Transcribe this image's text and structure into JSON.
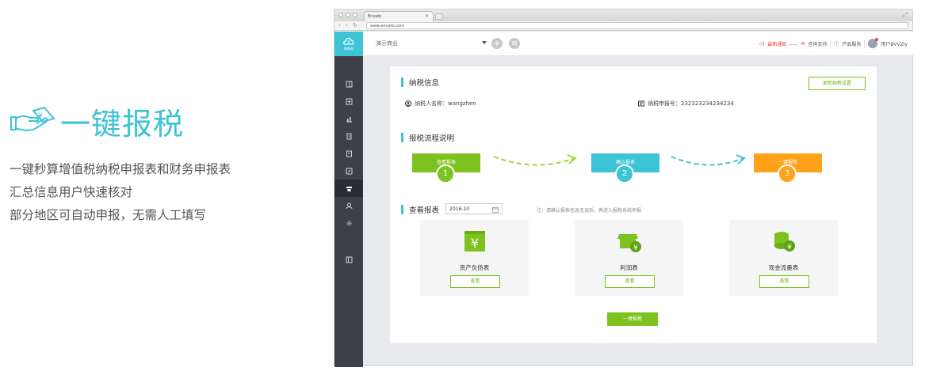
{
  "hero": {
    "title": "一键报税",
    "lines": [
      "一键秒算增值税纳税申报表和财务申报表",
      "汇总信息用户快速核对",
      "部分地区可自动申报，无需人工填写"
    ]
  },
  "browser": {
    "tab_title": "Envato",
    "url": "www.envato.com"
  },
  "app": {
    "logo_label": "税表报",
    "company_select": "演示商业",
    "notice_label": "最新通知 ——",
    "support_label": "咨询支持",
    "product_label": "产品服务",
    "user_label": "用户BVVZIy",
    "section_tax_info": "纳税信息",
    "update_settings_button": "更新纳税设置",
    "taxpayer_name": "纳税人名称：wangzhen",
    "taxpayer_id": "纳税申报号：232323234234234",
    "section_flow": "报税流程说明",
    "steps": [
      {
        "label": "查看报表",
        "num": "1",
        "color": "#7dc21e"
      },
      {
        "label": "确认报表",
        "num": "2",
        "color": "#3cc3d4"
      },
      {
        "label": "一键报税",
        "num": "3",
        "color": "#ffa21a"
      }
    ],
    "section_reports": "查看报表",
    "date_value": "2016-10",
    "note": "注：请确认报表信息无误后，再进入报税系统申报",
    "cards": [
      {
        "label": "资产负债表",
        "button": "查看"
      },
      {
        "label": "利润表",
        "button": "查看"
      },
      {
        "label": "现金流量表",
        "button": "查看"
      }
    ],
    "submit_button": "一键报税",
    "colors": {
      "accent": "#3cc3d4",
      "green": "#7dc21e",
      "orange": "#ffa21a",
      "sidebar": "#3d4047"
    }
  }
}
